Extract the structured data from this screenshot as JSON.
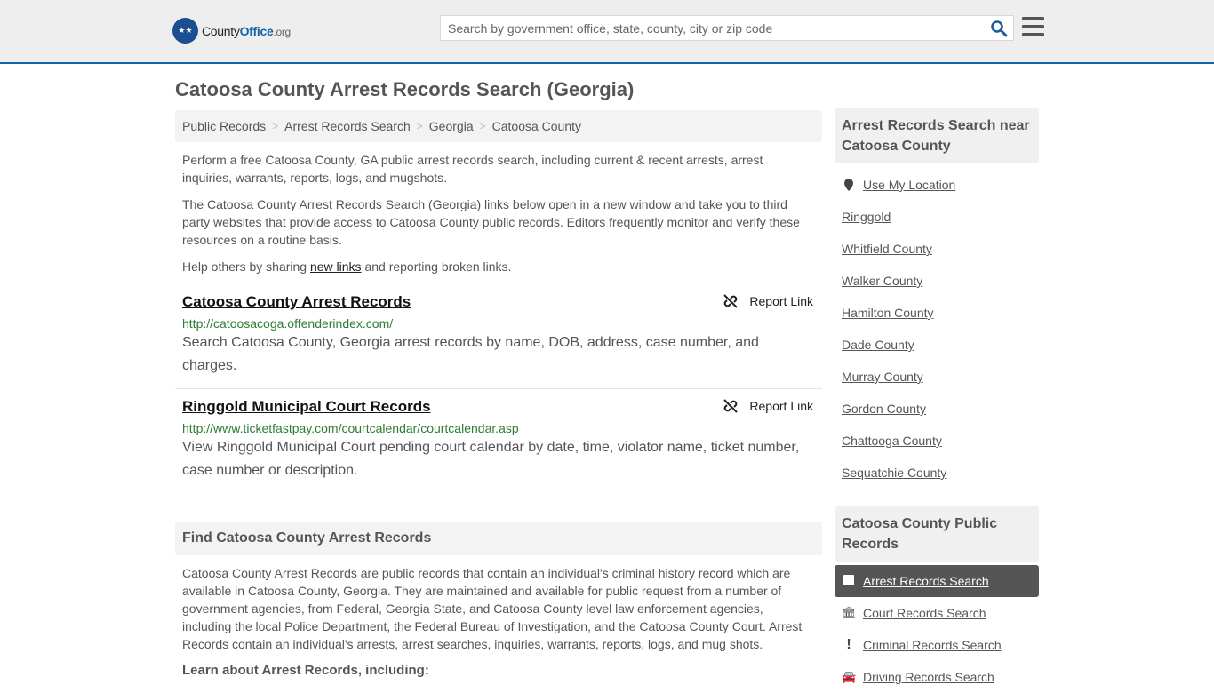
{
  "header": {
    "logo_primary": "County",
    "logo_office": "Office",
    "logo_tld": ".org",
    "search_placeholder": "Search by government office, state, county, city or zip code"
  },
  "page_title": "Catoosa County Arrest Records Search (Georgia)",
  "breadcrumbs": [
    "Public Records",
    "Arrest Records Search",
    "Georgia",
    "Catoosa County"
  ],
  "intro": {
    "p1": "Perform a free Catoosa County, GA public arrest records search, including current & recent arrests, arrest inquiries, warrants, reports, logs, and mugshots.",
    "p2": "The Catoosa County Arrest Records Search (Georgia) links below open in a new window and take you to third party websites that provide access to Catoosa County public records. Editors frequently monitor and verify these resources on a routine basis.",
    "p3_before": "Help others by sharing ",
    "p3_link": "new links",
    "p3_after": " and reporting broken links."
  },
  "records": [
    {
      "title": "Catoosa County Arrest Records",
      "url": "http://catoosacoga.offenderindex.com/",
      "description": "Search Catoosa County, Georgia arrest records by name, DOB, address, case number, and charges.",
      "report_label": "Report Link"
    },
    {
      "title": "Ringgold Municipal Court Records",
      "url": "http://www.ticketfastpay.com/courtcalendar/courtcalendar.asp",
      "description": "View Ringgold Municipal Court pending court calendar by date, time, violator name, ticket number, case number or description.",
      "report_label": "Report Link"
    }
  ],
  "find_section": {
    "heading": "Find Catoosa County Arrest Records",
    "body": "Catoosa County Arrest Records are public records that contain an individual's criminal history record which are available in Catoosa County, Georgia. They are maintained and available for public request from a number of government agencies, from Federal, Georgia State, and Catoosa County level law enforcement agencies, including the local Police Department, the Federal Bureau of Investigation, and the Catoosa County Court. Arrest Records contain an individual's arrests, arrest searches, inquiries, warrants, reports, logs, and mug shots.",
    "learn_heading": "Learn about Arrest Records, including:"
  },
  "sidebar": {
    "nearby_heading": "Arrest Records Search near Catoosa County",
    "use_location": "Use My Location",
    "nearby": [
      "Ringgold",
      "Whitfield County",
      "Walker County",
      "Hamilton County",
      "Dade County",
      "Murray County",
      "Gordon County",
      "Chattooga County",
      "Sequatchie County"
    ],
    "public_heading": "Catoosa County Public Records",
    "public_items": [
      {
        "label": "Arrest Records Search",
        "icon": "square-icon",
        "active": true
      },
      {
        "label": "Court Records Search",
        "icon": "courthouse-icon",
        "active": false
      },
      {
        "label": "Criminal Records Search",
        "icon": "exclamation-icon",
        "active": false
      },
      {
        "label": "Driving Records Search",
        "icon": "car-icon",
        "active": false
      }
    ]
  }
}
